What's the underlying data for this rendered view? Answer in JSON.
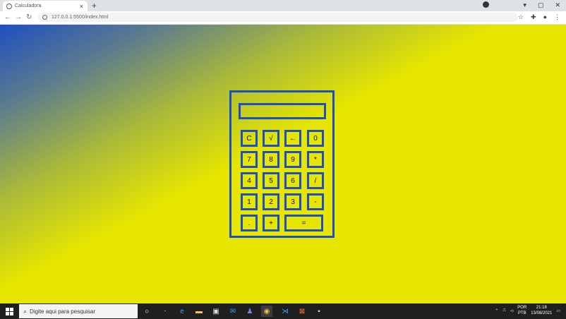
{
  "browser": {
    "tab_title": "Calculadora",
    "url": "127.0.0.1:5500/index.html",
    "new_tab_symbol": "+",
    "tab_close_symbol": "×"
  },
  "colors": {
    "accent": "#1e4fc0",
    "page_yellow": "#e6e600",
    "taskbar": "#1f1f1f"
  },
  "calculator": {
    "display_value": "",
    "keys": [
      "C",
      "√",
      "←",
      "0",
      "7",
      "8",
      "9",
      "*",
      "4",
      "5",
      "6",
      "/",
      "1",
      "2",
      "3",
      "-",
      ".",
      "+",
      "="
    ]
  },
  "taskbar": {
    "search_placeholder": "Digite aqui para pesquisar",
    "lang_line1": "POR",
    "lang_line2": "PTB",
    "time": "21:18",
    "date": "13/08/2021"
  },
  "icons": [
    "chrome-icon",
    "back-arrow-icon",
    "forward-arrow-icon",
    "reload-icon",
    "star-icon",
    "extensions-icon",
    "profile-icon",
    "menu-dots-icon",
    "windows-start-icon",
    "search-icon",
    "cortana-icon",
    "task-view-icon",
    "edge-icon",
    "file-explorer-icon",
    "store-icon",
    "mail-icon",
    "teams-icon",
    "chrome-taskbar-icon",
    "vscode-icon",
    "xampp-icon",
    "terminal-icon"
  ]
}
